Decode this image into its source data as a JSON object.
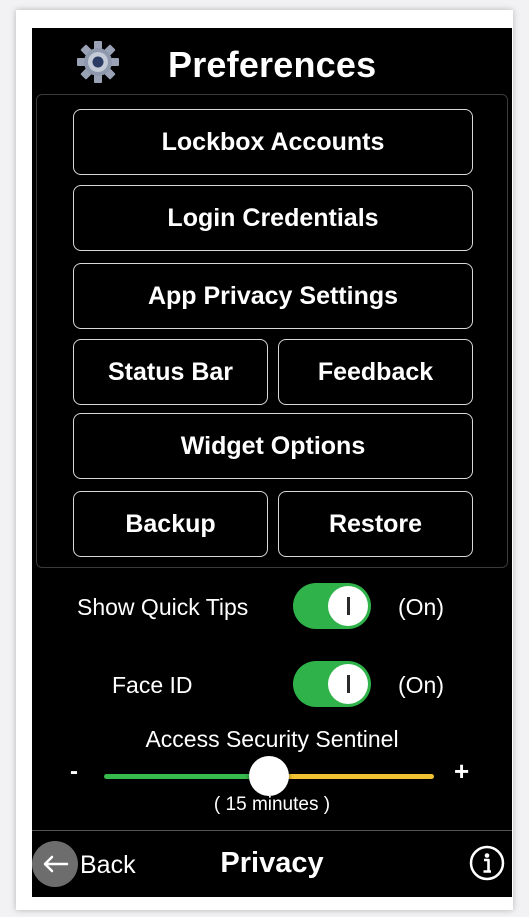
{
  "header": {
    "title": "Preferences",
    "icon": "gear-icon"
  },
  "menu": {
    "lockbox_accounts": "Lockbox Accounts",
    "login_credentials": "Login Credentials",
    "app_privacy_settings": "App Privacy Settings",
    "status_bar": "Status Bar",
    "feedback": "Feedback",
    "widget_options": "Widget Options",
    "backup": "Backup",
    "restore": "Restore"
  },
  "settings": {
    "quick_tips": {
      "label": "Show Quick Tips",
      "state": "(On)",
      "on": true
    },
    "face_id": {
      "label": "Face ID",
      "state": "(On)",
      "on": true
    }
  },
  "slider": {
    "title": "Access Security Sentinel",
    "minus": "-",
    "plus": "+",
    "value_text": "( 15 minutes )",
    "fraction": 0.5
  },
  "bottom_bar": {
    "back_label": "Back",
    "title": "Privacy",
    "back_icon": "back-arrow-icon",
    "info_icon": "info-icon"
  },
  "colors": {
    "toggle_on": "#2fb24a",
    "slider_left": "#36b94d",
    "slider_right": "#f1c232",
    "background": "#000000"
  }
}
